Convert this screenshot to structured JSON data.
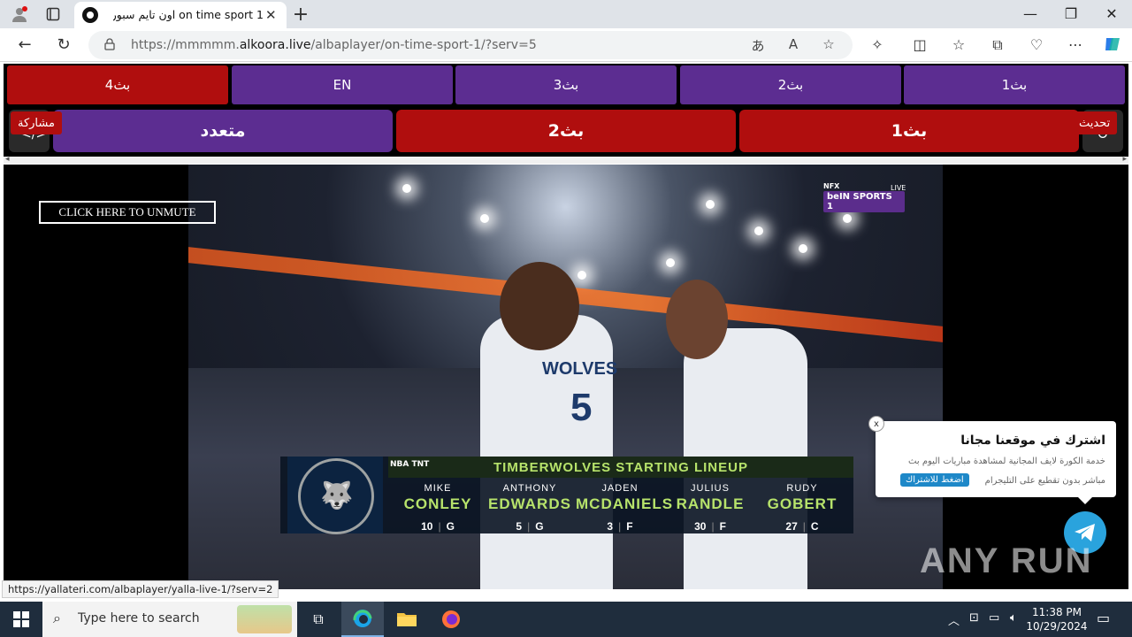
{
  "browser": {
    "tab_title": "on time sport 1 اون تايم سبورت",
    "url_prefix": "https://mmmmm.",
    "url_domain": "alkoora.live",
    "url_path": "/albaplayer/on-time-sport-1/?serv=5"
  },
  "servers_row1": [
    "بث4",
    "EN",
    "بث3",
    "بث2",
    "بث1"
  ],
  "servers_row2": {
    "multi": "متعدد",
    "b2": "بث2",
    "b1": "بث1",
    "share_tag": "مشاركة",
    "refresh_tag": "تحديث"
  },
  "player": {
    "unmute_label": "CLICK HERE TO UNMUTE",
    "channel_top": "NFX",
    "channel_logo": "beIN SPORTS 1",
    "channel_live": "LIVE",
    "lineup": {
      "network": "NBA TNT",
      "title": "TIMBERWOLVES STARTING LINEUP",
      "players": [
        {
          "first": "MIKE",
          "last": "CONLEY",
          "num": "10",
          "pos": "G"
        },
        {
          "first": "ANTHONY",
          "last": "EDWARDS",
          "num": "5",
          "pos": "G"
        },
        {
          "first": "JADEN",
          "last": "MCDANIELS",
          "num": "3",
          "pos": "F"
        },
        {
          "first": "JULIUS",
          "last": "RANDLE",
          "num": "30",
          "pos": "F"
        },
        {
          "first": "RUDY",
          "last": "GOBERT",
          "num": "27",
          "pos": "C"
        }
      ]
    },
    "jersey_text": "WOLVES",
    "jersey_number": "5"
  },
  "promo": {
    "close": "x",
    "title": "اشترك في موقعنا مجانا",
    "line1": "خدمة الكورة لايف المجانية لمشاهدة مباريات اليوم بث",
    "line2": "مباشر بدون تقطيع على التليجرام",
    "button": "اضغط للاشتراك"
  },
  "watermark": "ANY RUN",
  "status_url": "https://yallateri.com/albaplayer/yalla-live-1/?serv=2",
  "taskbar": {
    "search_placeholder": "Type here to search",
    "time": "11:38 PM",
    "date": "10/29/2024"
  },
  "colors": {
    "purple": "#5c2d91",
    "red": "#b00e0e",
    "telegram": "#2aa3dd"
  }
}
